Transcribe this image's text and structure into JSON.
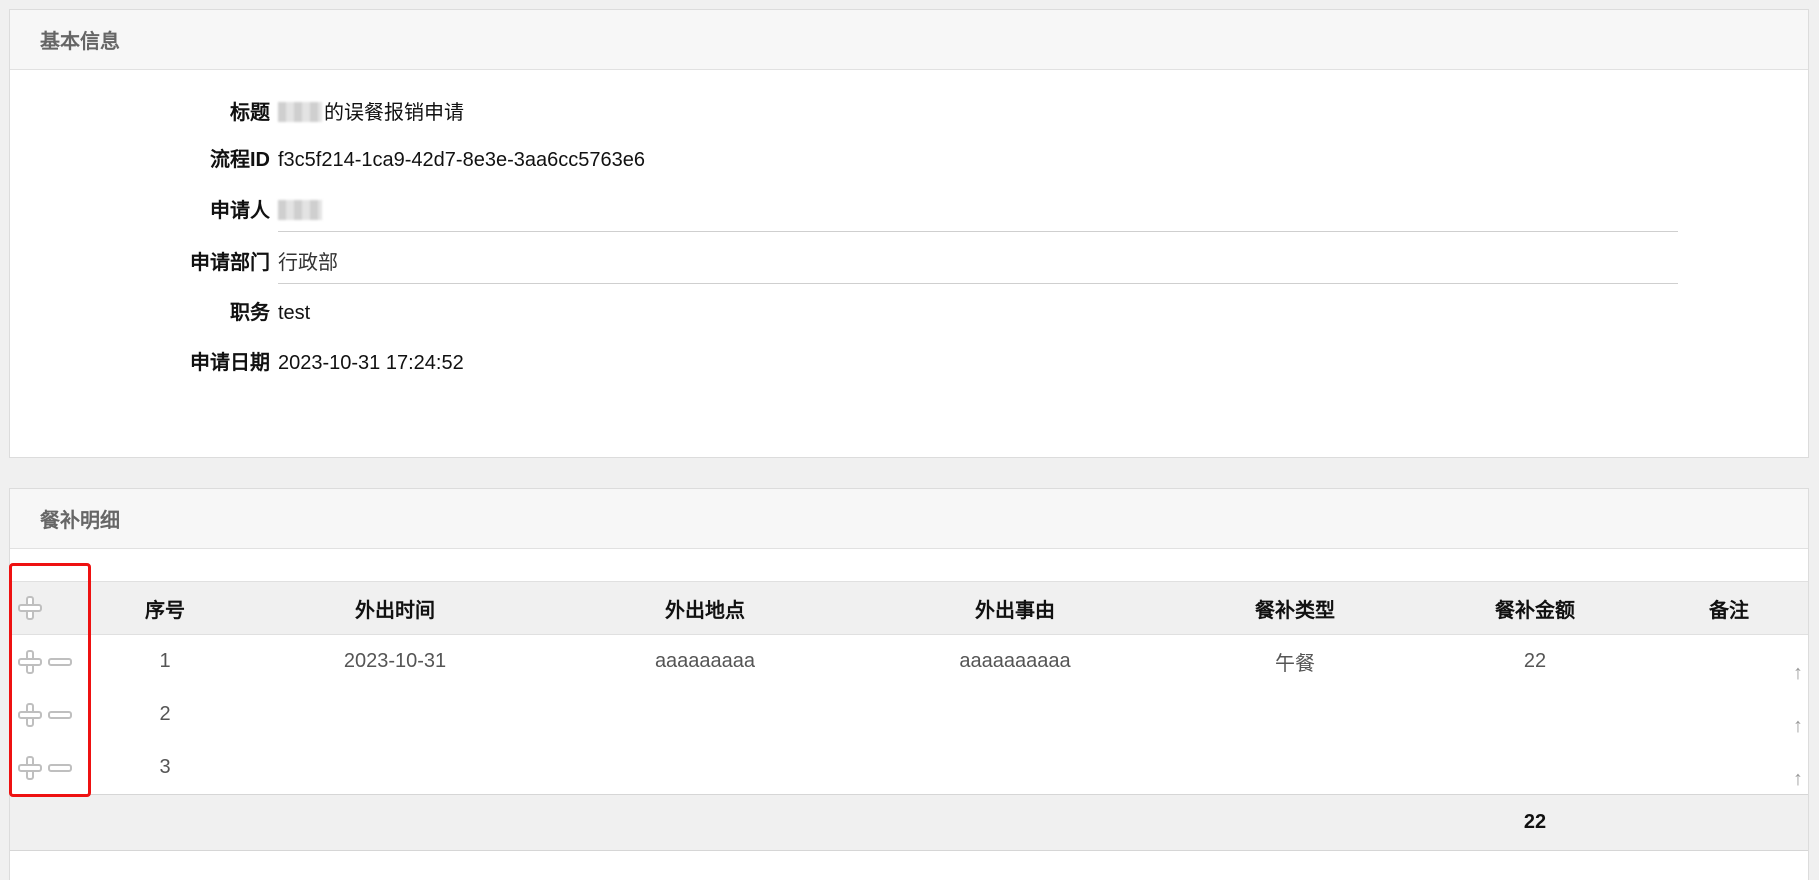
{
  "basic": {
    "header": "基本信息",
    "rows": [
      {
        "label": "标题",
        "value": "的误餐报销申请",
        "blurred": true
      },
      {
        "label": "流程ID",
        "value": "f3c5f214-1ca9-42d7-8e3e-3aa6cc5763e6"
      },
      {
        "label": "申请人",
        "value": "",
        "blurred": true
      },
      {
        "label": "申请部门",
        "value": "行政部"
      },
      {
        "label": "职务",
        "value": "test"
      },
      {
        "label": "申请日期",
        "value": "2023-10-31 17:24:52"
      }
    ]
  },
  "meal": {
    "header": "餐补明细",
    "columns": [
      "序号",
      "外出时间",
      "外出地点",
      "外出事由",
      "餐补类型",
      "餐补金额",
      "备注"
    ],
    "rows": [
      [
        "1",
        "2023-10-31",
        "aaaaaaaaa",
        "aaaaaaaaaa",
        "午餐",
        "22",
        ""
      ],
      [
        "2",
        "",
        "",
        "",
        "",
        "",
        ""
      ],
      [
        "3",
        "",
        "",
        "",
        "",
        "",
        ""
      ]
    ],
    "total": "22",
    "sort_arrow": "↑"
  },
  "icons": {
    "add": "plus-icon",
    "remove": "minus-icon"
  },
  "colors": {
    "highlight_box": "#ee1111",
    "icon_gray": "#bfbfbf"
  }
}
